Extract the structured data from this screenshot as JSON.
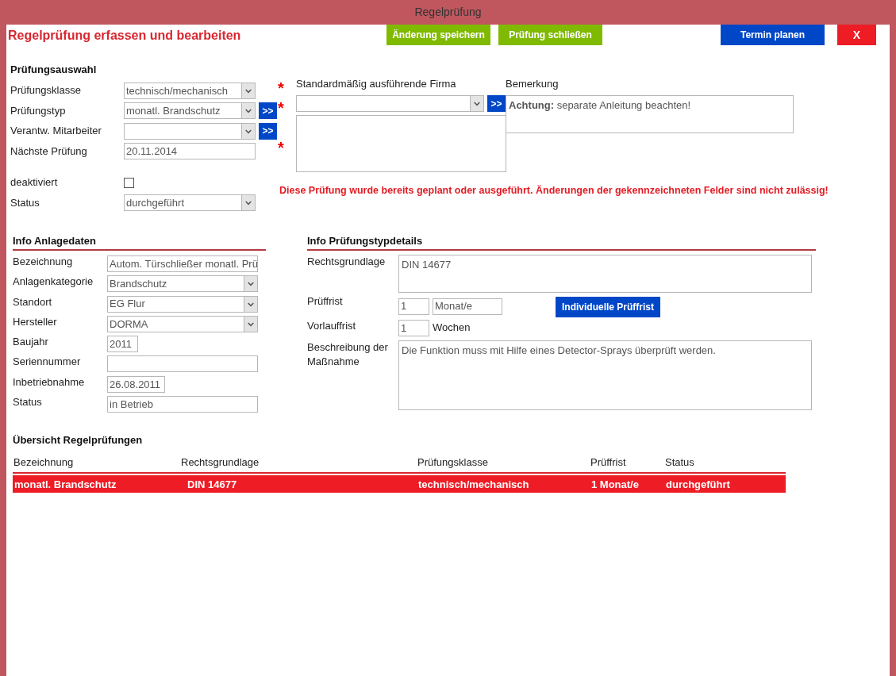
{
  "window": {
    "title": "Regelprüfung"
  },
  "header": {
    "title": "Regelprüfung erfassen und bearbeiten",
    "buttons": [
      {
        "label": "Änderung speichern",
        "kind": "save"
      },
      {
        "label": "Prüfung schließen",
        "kind": "save"
      },
      {
        "label": "Termin planen",
        "kind": "plan"
      },
      {
        "label": "X",
        "kind": "close"
      }
    ]
  },
  "pruefungsauswahl": {
    "heading": "Prüfungsauswahl",
    "fields": [
      {
        "label": "Prüfungsklasse",
        "kind": "select",
        "value": "technisch/mechanisch"
      },
      {
        "label": "Prüfungstyp",
        "kind": "select",
        "value": "monatl. Brandschutz",
        "action": ">>"
      },
      {
        "label": "Verantw. Mitarbeiter",
        "kind": "select",
        "action": ">>"
      },
      {
        "label": "Nächste Prüfung",
        "kind": "text",
        "value": "20.11.2014"
      },
      {
        "label": "deaktiviert",
        "kind": "checkbox",
        "checked": false
      },
      {
        "label": "Status",
        "kind": "select",
        "value": "durchgeführt"
      }
    ]
  },
  "firma": {
    "label": "Standardmäßig ausführende Firma",
    "markers": [
      "*",
      "*",
      "*"
    ],
    "action": ">>"
  },
  "bemerkung": {
    "label": "Bemerkung",
    "value": "**Achtung:** separate Anleitung beachten!"
  },
  "warning": "Diese Prüfung wurde bereits geplant oder ausgeführt. Änderungen der gekennzeichneten Felder sind nicht zulässig!",
  "anlagedaten": {
    "heading": "Info Anlagedaten",
    "fields": [
      {
        "label": "Bezeichnung",
        "kind": "text",
        "value": "Autom. Türschließer monatl. Prü"
      },
      {
        "label": "Anlagenkategorie",
        "kind": "select",
        "value": "Brandschutz"
      },
      {
        "label": "Standort",
        "kind": "select",
        "value": "EG Flur"
      },
      {
        "label": "Hersteller",
        "kind": "select",
        "value": "DORMA"
      },
      {
        "label": "Baujahr",
        "kind": "short",
        "value": "2011"
      },
      {
        "label": "Seriennummer",
        "kind": "text"
      },
      {
        "label": "Inbetriebnahme",
        "kind": "date",
        "value": "26.08.2011"
      },
      {
        "label": "Status",
        "kind": "text",
        "value": "in Betrieb"
      }
    ]
  },
  "pruefungstypdetails": {
    "heading": "Info Prüfungstypdetails",
    "fields": [
      {
        "label": "Rechtsgrundlage",
        "kind": "area",
        "value": "DIN 14677"
      },
      {
        "label": "Prüffrist",
        "kind": "period",
        "value": "1",
        "unit": "Monat/e",
        "button": "Individuelle Prüffrist"
      },
      {
        "label": "Vorlauffrist",
        "kind": "period",
        "value": "1",
        "suffix": "Wochen"
      },
      {
        "label": "Beschreibung der Maßnahme",
        "kind": "bigarea",
        "value": "Die Funktion muss mit Hilfe eines Detector-Sprays überprüft werden."
      }
    ]
  },
  "overview": {
    "heading": "Übersicht Regelprüfungen",
    "columns": [
      "Bezeichnung",
      "Rechtsgrundlage",
      "Prüfungsklasse",
      "Prüffrist",
      "Status"
    ],
    "rows": [
      {
        "selected": true,
        "cells": [
          "monatl. Brandschutz",
          "DIN 14677",
          "technisch/mechanisch",
          "1 Monat/e",
          "durchgeführt"
        ]
      }
    ]
  }
}
